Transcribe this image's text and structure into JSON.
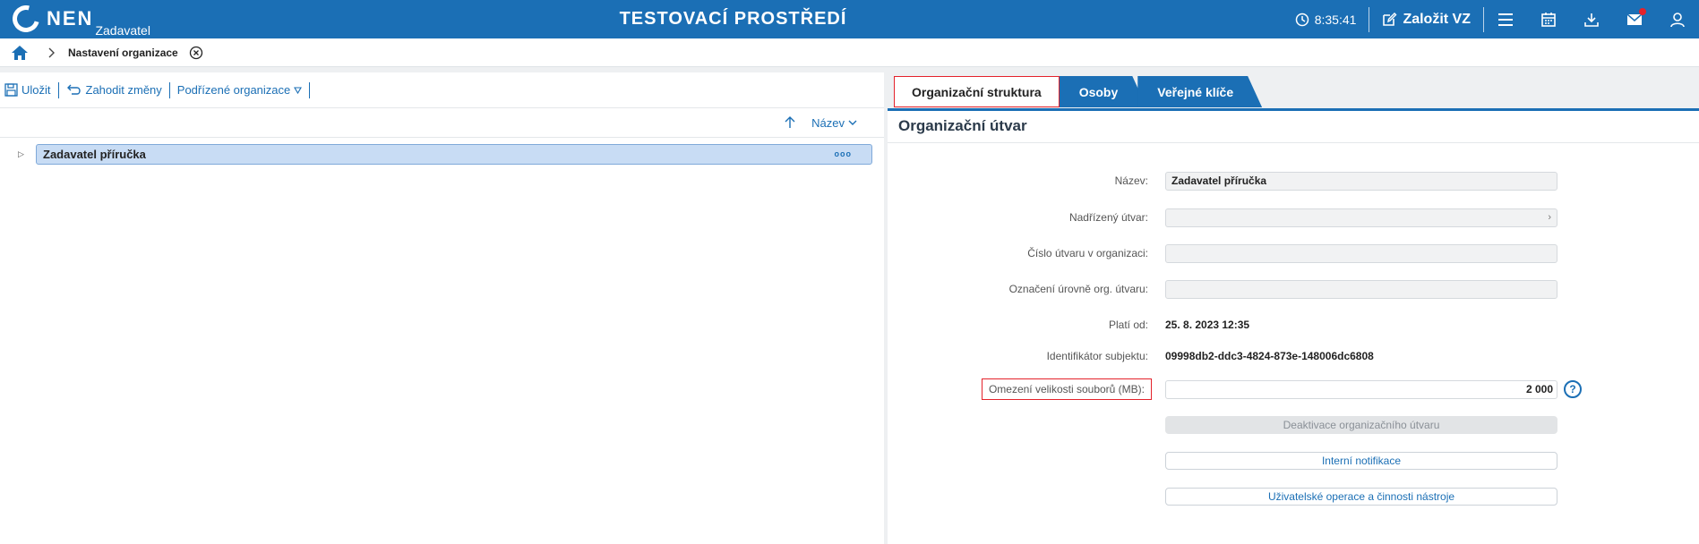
{
  "header": {
    "logo_text": "NEN",
    "logo_sub": "Zadavatel",
    "env_title": "TESTOVACÍ PROSTŘEDÍ",
    "time": "8:35:41",
    "create_label": "Založit VZ",
    "icons": [
      "clock-icon",
      "edit-icon",
      "menu-icon",
      "calendar-icon",
      "download-icon",
      "mail-icon",
      "user-icon"
    ],
    "brand_color": "#1b6fb5",
    "notification_color": "#e4222b"
  },
  "breadcrumb": {
    "current": "Nastavení organizace"
  },
  "left": {
    "toolbar": {
      "save": "Uložit",
      "discard": "Zahodit změny",
      "sub_orgs": "Podřízené organizace"
    },
    "sort": {
      "label": "Název"
    },
    "tree": {
      "item": "Zadavatel příručka",
      "more": "ooo"
    }
  },
  "right": {
    "tabs": [
      "Organizační struktura",
      "Osoby",
      "Veřejné klíče"
    ],
    "section_title": "Organizační útvar",
    "fields": {
      "nazev_label": "Název:",
      "nazev_value": "Zadavatel příručka",
      "nadrizeny_label": "Nadřízený útvar:",
      "cislo_label": "Číslo útvaru v organizaci:",
      "oznaceni_label": "Označení úrovně org. útvaru:",
      "plati_label": "Platí od:",
      "plati_value": "25. 8. 2023 12:35",
      "ident_label": "Identifikátor subjektu:",
      "ident_value": "09998db2-ddc3-4824-873e-148006dc6808",
      "omezeni_label": "Omezení velikosti souborů (MB):",
      "omezeni_value": "2 000"
    },
    "buttons": {
      "deactivate": "Deaktivace organizačního útvaru",
      "notifications": "Interní notifikace",
      "operations": "Uživatelské operace a činnosti nástroje"
    }
  }
}
